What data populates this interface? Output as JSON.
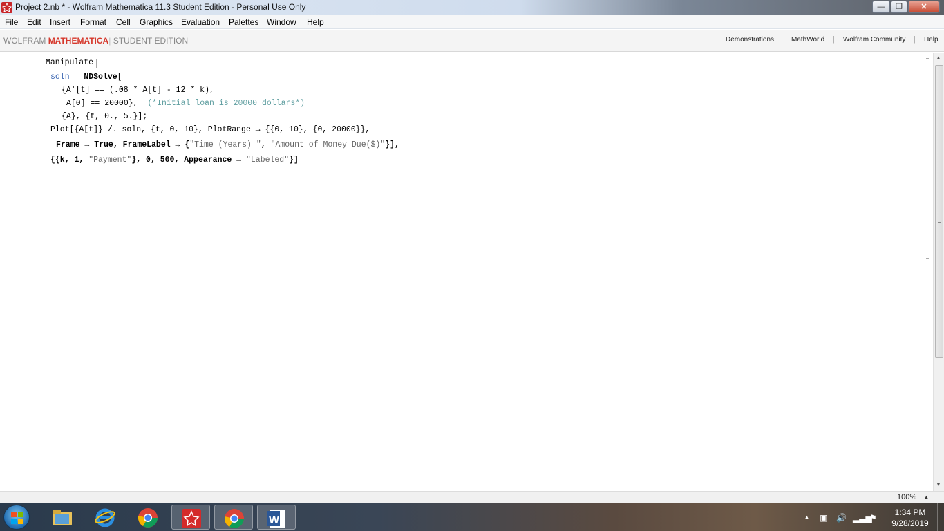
{
  "window": {
    "title": "Project 2.nb * - Wolfram Mathematica 11.3 Student Edition - Personal Use Only",
    "minimize": "—",
    "maximize": "❐",
    "close": "✕"
  },
  "menu": [
    "File",
    "Edit",
    "Insert",
    "Format",
    "Cell",
    "Graphics",
    "Evaluation",
    "Palettes",
    "Window",
    "Help"
  ],
  "brand": {
    "wolfram": "WOLFRAM",
    "mathematica": "MATHEMATICA",
    "separator": "|",
    "edition": "STUDENT EDITION"
  },
  "top_links": [
    "Demonstrations",
    "MathWorld",
    "Wolfram Community",
    "Help"
  ],
  "code": {
    "line1": "Manipulate",
    "line2_a": "soln",
    "line2_b": " = ",
    "line2_c": "NDSolve",
    "line2_d": "[",
    "line3_a": "{A'[t] == (.08 ",
    "line3_b": "*",
    "line3_c": " A[t] - 12 ",
    "line3_d": "*",
    "line3_e": " k),",
    "line4_a": "A[0] == 20000},",
    "line4_comment": "(*Initial loan is 20000 dollars*)",
    "line5": "{A}, {t, 0., 5.}];",
    "line6": "Plot[{A[t]} /. soln, {t, 0, 10}, PlotRange → {{0, 10}, {0, 20000}},",
    "line7_a": "Frame → True, FrameLabel → {",
    "line7_str1": "\"Time (Years) \"",
    "line7_b": ", ",
    "line7_str2": "\"Amount of Money Due($)\"",
    "line7_c": "}],",
    "line8_a": "{{k, 1, ",
    "line8_str1": "\"Payment\"",
    "line8_b": "}, 0, 500, Appearance → ",
    "line8_str2": "\"Labeled\"",
    "line8_c": "}]"
  },
  "status": {
    "zoom": "100%",
    "zoom_arrow": "▲"
  },
  "taskbar": {
    "apps": [
      "file-explorer",
      "internet-explorer",
      "chrome",
      "mathematica",
      "chrome",
      "word"
    ],
    "clock_time": "1:34 PM",
    "clock_date": "9/28/2019"
  },
  "colors": {
    "accent_red": "#d6382c",
    "symbol_blue": "#3864b0",
    "comment_teal": "#5f9ea0"
  }
}
